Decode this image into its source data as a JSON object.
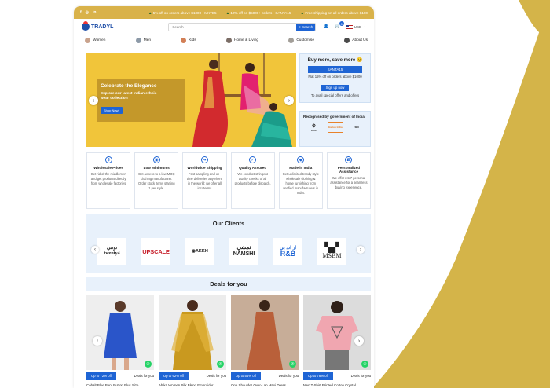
{
  "colors": {
    "accent": "#1e64d4",
    "gold": "#d9b24a",
    "panel": "#e8f1fb"
  },
  "topbar": {
    "social": [
      "f",
      "◎",
      "in"
    ],
    "promos": [
      "5% off on orders above $1000 - MKTB5",
      "10% off on $5000+ orders - SANTA15",
      "Free shipping on all orders above $100"
    ]
  },
  "header": {
    "logo": "TRADYL",
    "search_placeholder": "Search",
    "search_button": "Search",
    "cart_count": "0",
    "currency": "USD"
  },
  "categories": [
    {
      "label": "Women",
      "icon": "women-category-thumb"
    },
    {
      "label": "Men",
      "icon": "men-category-thumb"
    },
    {
      "label": "Kids",
      "icon": "kids-category-thumb"
    },
    {
      "label": "Home & Living",
      "icon": "home-category-thumb"
    },
    {
      "label": "Customise",
      "icon": "customise-category-thumb"
    },
    {
      "label": "About Us",
      "icon": "about-category-thumb"
    }
  ],
  "hero": {
    "title": "Celebrate the Elegance",
    "subtitle": "Explore our latest Indian ethnic wear collection",
    "button": "Shop Now!"
  },
  "offer": {
    "title": "Buy more, save more",
    "code": "SANTA15",
    "line1": "Flat 15% off on orders above $1000",
    "signup": "Sign up now",
    "line2": "To avail special offers and offers"
  },
  "recognition": {
    "title": "Recognised by government of India",
    "logos": [
      "KVIC",
      "Startup India",
      "FIEO"
    ]
  },
  "features": [
    {
      "title": "Wholesale Prices",
      "text": "Get rid of the middlemen and get products directly from wholesale factories",
      "icon": "price-tag-icon"
    },
    {
      "title": "Low Minimums",
      "text": "Get access to a low MOQ clothing manufacturer. Order stock items starting 1 per style.",
      "icon": "box-icon"
    },
    {
      "title": "Worldwide Shipping",
      "text": "Fast sampling and on-time deliveries anywhere in the world; we offer all incoterms",
      "icon": "truck-icon"
    },
    {
      "title": "Quality Assured",
      "text": "We conduct stringent quality checks of all products before dispatch.",
      "icon": "shield-icon"
    },
    {
      "title": "Made in India",
      "text": "Get unlimited trendy style wholesale clothing & home furnishing from verified manufacturers in India.",
      "icon": "india-icon"
    },
    {
      "title": "Personalized Assistance",
      "text": "We offer 24x7 personal assistance for a seamless buying experience.",
      "icon": "headset-icon"
    }
  ],
  "clients": {
    "title": "Our Clients",
    "logos": [
      {
        "top": "تونتي",
        "bottom": "twenty4"
      },
      {
        "text": "UPSCALE"
      },
      {
        "text": "AKKH"
      },
      {
        "top": "نمشي",
        "bottom": "NAMSHI"
      },
      {
        "top": "ار اند بي",
        "bottom": "R&B"
      },
      {
        "top": "▚▞",
        "bottom": "MSBM"
      }
    ]
  },
  "deals": {
    "title": "Deals for you",
    "products": [
      {
        "discount": "Up to 72% off",
        "deal": "Deals for you",
        "name": "Cobalt Blue Bent Button Plus Size ..."
      },
      {
        "discount": "Up to 62% off",
        "deal": "Deals for you",
        "name": "Ahika Women Silk Blend Embroider..."
      },
      {
        "discount": "Up to 54% off",
        "deal": "Deals for you",
        "name": "One Shoulder Over-Lap Maxi Dress"
      },
      {
        "discount": "Up to 78% off",
        "deal": "Deals for you",
        "name": "Men T-Shirt Printed Cotton Crystal"
      }
    ]
  }
}
